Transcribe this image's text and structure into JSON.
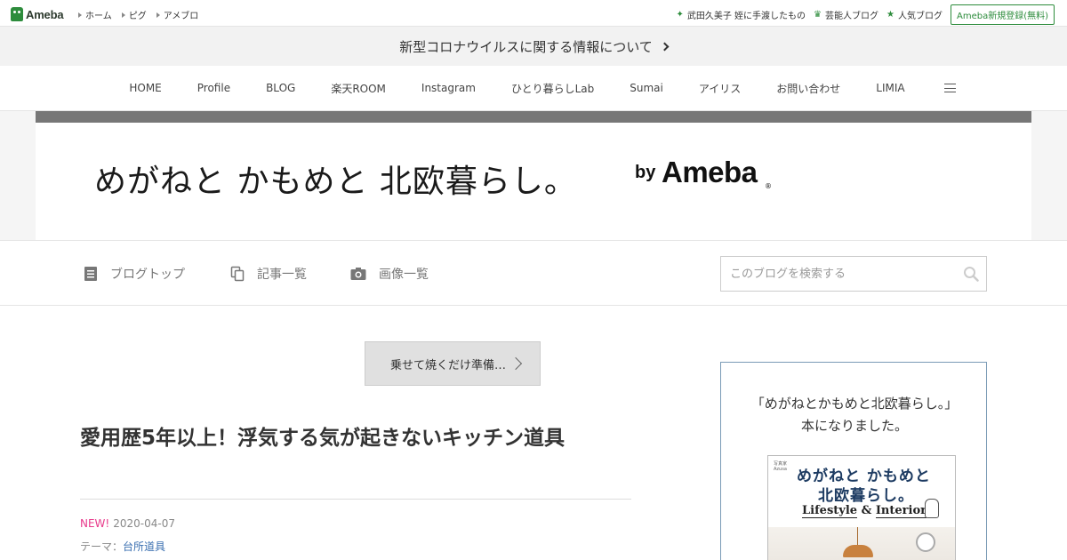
{
  "topbar": {
    "logo": "Ameba",
    "links": [
      "ホーム",
      "ピグ",
      "アメブロ"
    ],
    "right_items": [
      {
        "label": "武田久美子 姪に手渡したもの",
        "icon": "sparkle-icon"
      },
      {
        "label": "芸能人ブログ",
        "icon": "crown-icon"
      },
      {
        "label": "人気ブログ",
        "icon": "star-icon"
      }
    ],
    "register": "Ameba新規登録(無料)"
  },
  "notice": "新型コロナウイルスに関する情報について",
  "nav": [
    "HOME",
    "Profile",
    "BLOG",
    "楽天ROOM",
    "Instagram",
    "ひとり暮らしLab",
    "Sumai",
    "アイリス",
    "お問い合わせ",
    "LIMIA"
  ],
  "banner": {
    "title": "めがねと かもめと 北欧暮らし。",
    "by": "by",
    "brand": "Ameba",
    "reg": "®"
  },
  "toolbar": {
    "blog_top": "ブログトップ",
    "entry_list": "記事一覧",
    "image_list": "画像一覧",
    "search_placeholder": "このブログを検索する"
  },
  "entry": {
    "prev_label": "乗せて焼くだけ準備…",
    "title": "愛用歴5年以上！浮気する気が起きないキッチン道具",
    "new": "NEW!",
    "date": "2020-04-07",
    "theme_label": "テーマ：",
    "theme": "台所道具"
  },
  "sidebar": {
    "line1": "「めがねとかもめと北欧暮らし。」",
    "line2": "本になりました。",
    "book": {
      "small": "写真家\nAzusa",
      "line1": "めがねと かもめと",
      "line2": "北欧暮らし。",
      "lifestyle": "Lifestyle",
      "amp": "&",
      "interior": "Interior"
    }
  },
  "colors": {
    "ameba_green": "#2d8c3c",
    "new_pink": "#e83a8b",
    "link_blue": "#3a6fb0",
    "book_navy": "#1d3b62"
  }
}
